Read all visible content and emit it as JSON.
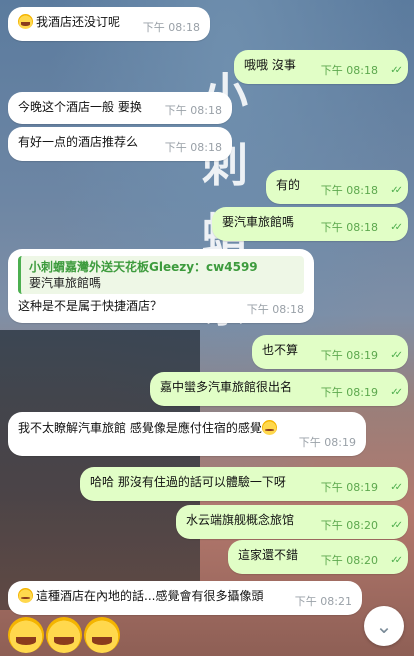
{
  "background_text": [
    "小",
    "刺",
    "蝟",
    "茶"
  ],
  "messages": [
    {
      "text": "我酒店还没订呢",
      "time": "下午 08:18"
    },
    {
      "text": "哦哦  沒事",
      "time": "下午 08:18"
    },
    {
      "text": "今晚这个酒店一般 要换",
      "time": "下午 08:18"
    },
    {
      "text": "有好一点的酒店推荐么",
      "time": "下午 08:18"
    },
    {
      "text": "有的",
      "time": "下午 08:18"
    },
    {
      "text": "要汽車旅館嗎",
      "time": "下午 08:18"
    },
    {
      "quote_name": "小刺蝟嘉灣外送天花板Gleezy：cw4599",
      "quote_text": "要汽車旅館嗎",
      "text": "这种是不是属于快捷酒店？",
      "time": "下午 08:18"
    },
    {
      "text": "也不算",
      "time": "下午 08:19"
    },
    {
      "text": "嘉中蠻多汽車旅館很出名",
      "time": "下午 08:19"
    },
    {
      "text": "我不太瞭解汽車旅館 感覺像是應付住宿的感覺",
      "time": "下午 08:19"
    },
    {
      "text": "哈哈  那沒有住過的話可以體驗一下呀",
      "time": "下午 08:19"
    },
    {
      "text": "水云端旗舰概念旅馆",
      "time": "下午 08:20"
    },
    {
      "text": "這家還不錯",
      "time": "下午 08:20"
    },
    {
      "text": "這種酒店在內地的話...感覺會有很多攝像頭",
      "time": "下午 08:21"
    }
  ],
  "read_check": "✓✓",
  "scroll_icon": "chevron-down-icon",
  "scroll_glyph": "⌄"
}
